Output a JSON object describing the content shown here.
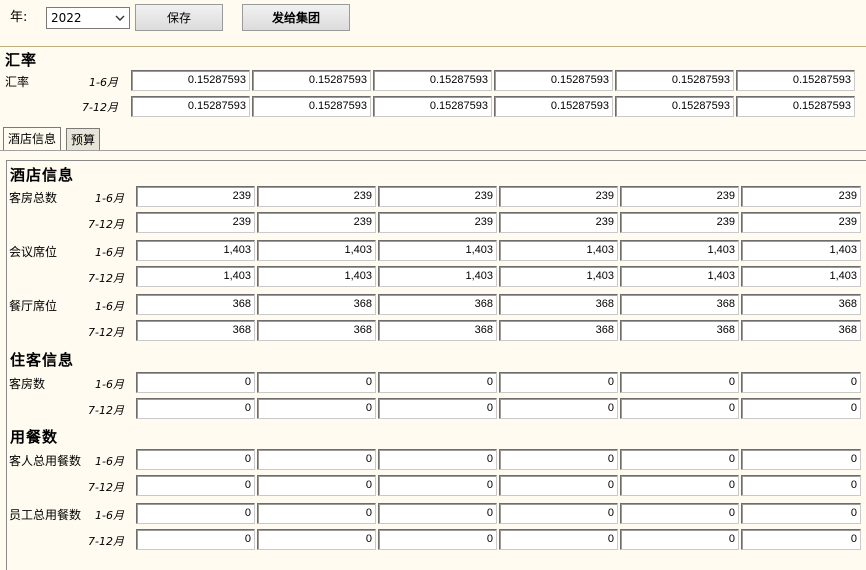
{
  "toolbar": {
    "year_label": "年:",
    "year_value": "2022",
    "save_label": "保存",
    "send_label": "发给集团"
  },
  "exchange": {
    "section_title": "汇率",
    "row_label": "汇率",
    "periods": [
      "1-6月",
      "7-12月"
    ],
    "rows": [
      [
        "0.15287593",
        "0.15287593",
        "0.15287593",
        "0.15287593",
        "0.15287593",
        "0.15287593"
      ],
      [
        "0.15287593",
        "0.15287593",
        "0.15287593",
        "0.15287593",
        "0.15287593",
        "0.15287593"
      ]
    ]
  },
  "tabs": [
    {
      "label": "酒店信息",
      "active": true
    },
    {
      "label": "预算",
      "active": false
    }
  ],
  "hotel_info": {
    "title": "酒店信息",
    "groups": [
      {
        "label": "客房总数",
        "rows": [
          [
            "239",
            "239",
            "239",
            "239",
            "239",
            "239"
          ],
          [
            "239",
            "239",
            "239",
            "239",
            "239",
            "239"
          ]
        ]
      },
      {
        "label": "会议席位",
        "rows": [
          [
            "1,403",
            "1,403",
            "1,403",
            "1,403",
            "1,403",
            "1,403"
          ],
          [
            "1,403",
            "1,403",
            "1,403",
            "1,403",
            "1,403",
            "1,403"
          ]
        ]
      },
      {
        "label": "餐厅席位",
        "rows": [
          [
            "368",
            "368",
            "368",
            "368",
            "368",
            "368"
          ],
          [
            "368",
            "368",
            "368",
            "368",
            "368",
            "368"
          ]
        ]
      }
    ]
  },
  "guest_info": {
    "title": "住客信息",
    "groups": [
      {
        "label": "客房数",
        "rows": [
          [
            "0",
            "0",
            "0",
            "0",
            "0",
            "0"
          ],
          [
            "0",
            "0",
            "0",
            "0",
            "0",
            "0"
          ]
        ]
      }
    ]
  },
  "meals": {
    "title": "用餐数",
    "groups": [
      {
        "label": "客人总用餐数",
        "rows": [
          [
            "0",
            "0",
            "0",
            "0",
            "0",
            "0"
          ],
          [
            "0",
            "0",
            "0",
            "0",
            "0",
            "0"
          ]
        ]
      },
      {
        "label": "员工总用餐数",
        "rows": [
          [
            "0",
            "0",
            "0",
            "0",
            "0",
            "0"
          ],
          [
            "0",
            "0",
            "0",
            "0",
            "0",
            "0"
          ]
        ]
      }
    ]
  },
  "periods": [
    "1-6月",
    "7-12月"
  ]
}
